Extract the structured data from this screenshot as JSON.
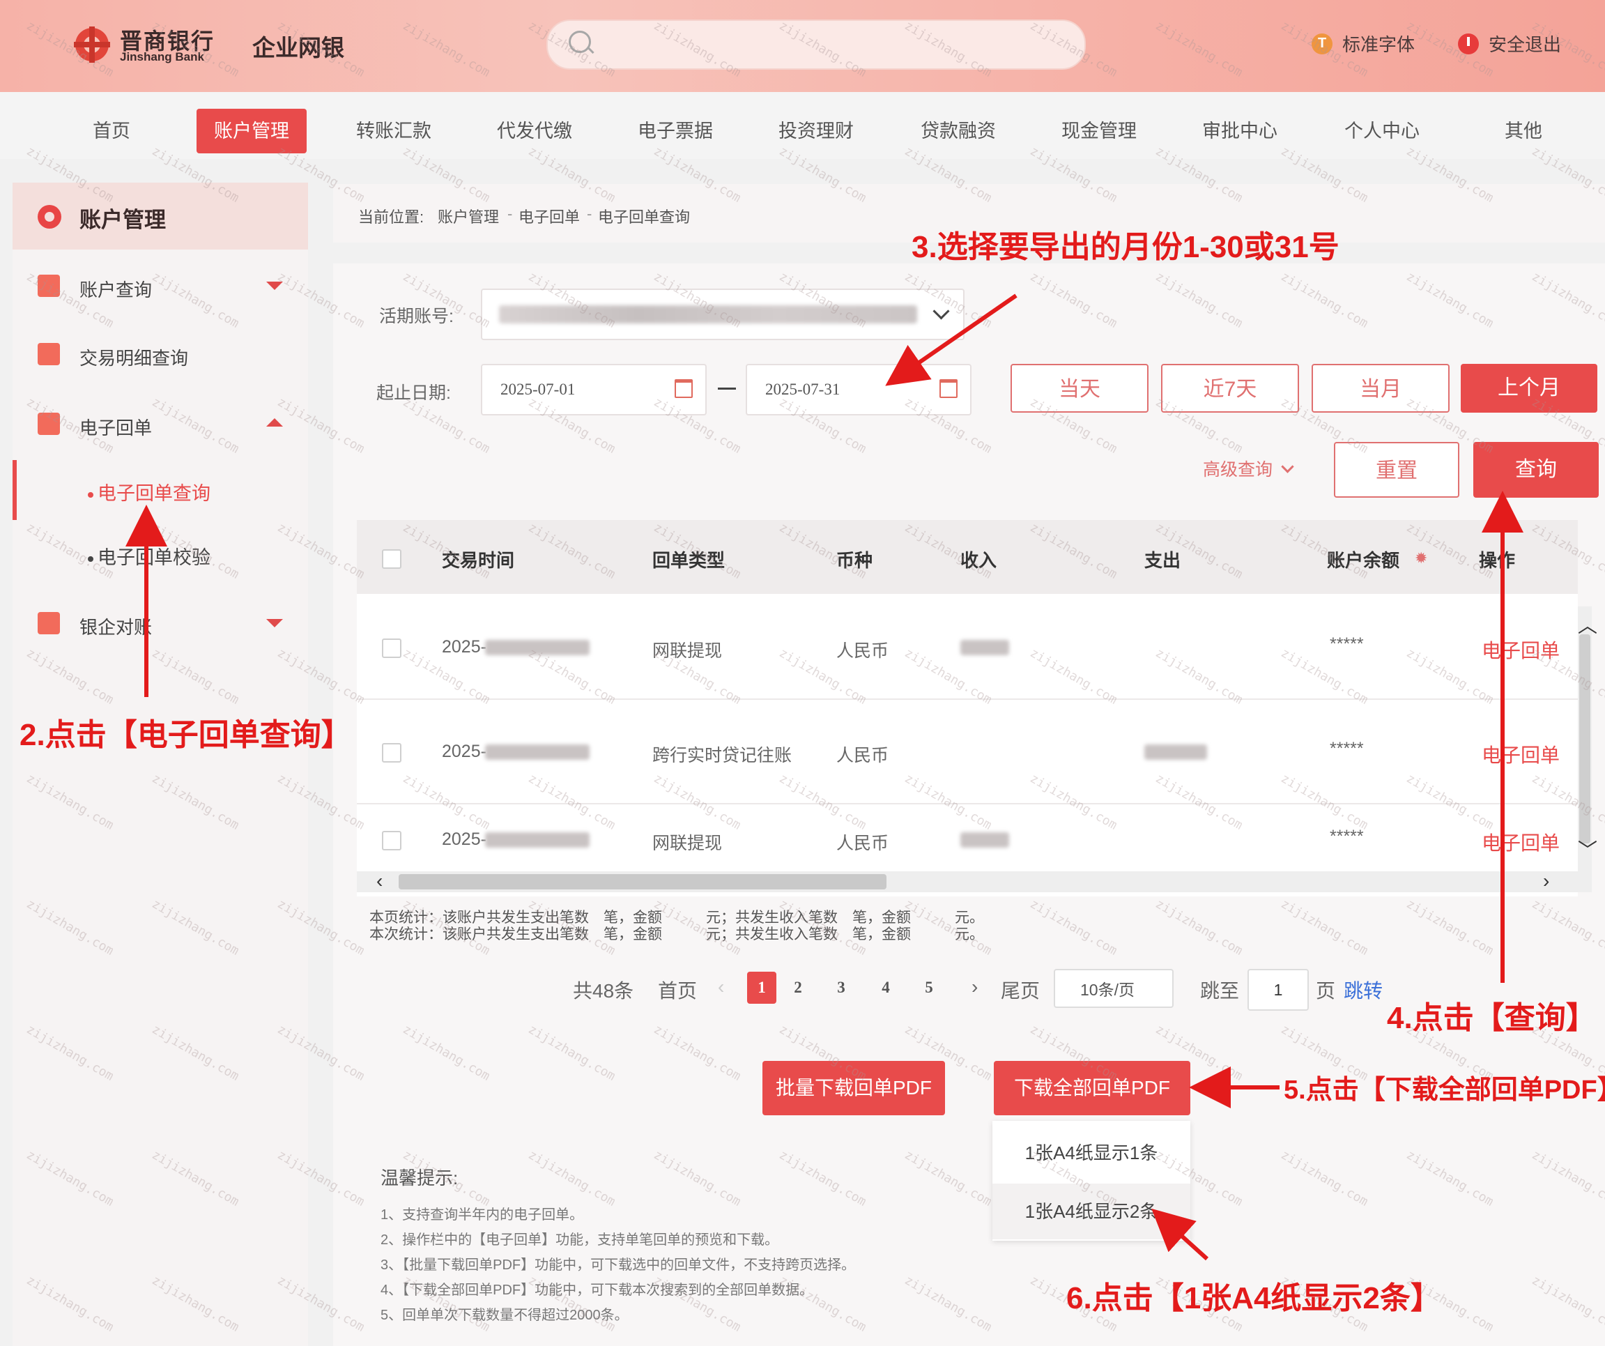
{
  "header": {
    "bank_name_cn": "晋商银行",
    "bank_name_en": "Jinshang Bank",
    "system_name": "企业网银",
    "font_link": "标准字体",
    "exit_link": "安全退出"
  },
  "nav": {
    "items": [
      "首页",
      "账户管理",
      "转账汇款",
      "代发代缴",
      "电子票据",
      "投资理财",
      "贷款融资",
      "现金管理",
      "审批中心",
      "个人中心",
      "其他"
    ],
    "active": "账户管理"
  },
  "sidebar": {
    "title": "账户管理",
    "items": [
      {
        "label": "账户查询"
      },
      {
        "label": "交易明细查询"
      },
      {
        "label": "电子回单"
      },
      {
        "label": "银企对账"
      }
    ],
    "subitems": [
      "电子回单查询",
      "电子回单校验"
    ]
  },
  "breadcrumb": {
    "prefix": "当前位置:",
    "path": [
      "账户管理",
      "电子回单",
      "电子回单查询"
    ]
  },
  "form": {
    "account_label": "活期账号:",
    "date_label": "起止日期:",
    "start_date": "2025-07-01",
    "end_date": "2025-07-31",
    "quick_buttons": [
      "当天",
      "近7天",
      "当月",
      "上个月"
    ],
    "advanced_label": "高级查询",
    "reset_label": "重置",
    "query_label": "查询"
  },
  "table": {
    "headers": [
      "交易时间",
      "回单类型",
      "币种",
      "收入",
      "支出",
      "账户余额",
      "操作"
    ],
    "rows": [
      {
        "time": "2025-",
        "type": "网联提现",
        "currency": "人民币",
        "balance": "*****",
        "action": "电子回单"
      },
      {
        "time": "2025-",
        "type": "跨行实时贷记往账",
        "currency": "人民币",
        "balance": "*****",
        "action": "电子回单"
      },
      {
        "time": "2025-",
        "type": "网联提现",
        "currency": "人民币",
        "balance": "*****",
        "action": "电子回单"
      }
    ]
  },
  "stats": {
    "page_line": "本页统计：该账户共发生支出笔数　笔，金额　　　元；共发生收入笔数　笔，金额　　　元。",
    "query_line": "本次统计：该账户共发生支出笔数　笔，金额　　　元；共发生收入笔数　笔，金额　　　元。"
  },
  "pager": {
    "total": "共48条",
    "first": "首页",
    "pages": [
      "1",
      "2",
      "3",
      "4",
      "5"
    ],
    "current": "1",
    "last": "尾页",
    "page_size": "10条/页",
    "jump_label": "跳至",
    "jump_value": "1",
    "page_unit": "页",
    "jump_button": "跳转"
  },
  "download": {
    "batch_label": "批量下载回单PDF",
    "all_label": "下载全部回单PDF",
    "options": [
      "1张A4纸显示1条",
      "1张A4纸显示2条"
    ]
  },
  "tips": {
    "title": "温馨提示:",
    "items": [
      "1、支持查询半年内的电子回单。",
      "2、操作栏中的【电子回单】功能，支持单笔回单的预览和下载。",
      "3、【批量下载回单PDF】功能中，可下载选中的回单文件，不支持跨页选择。",
      "4、【下载全部回单PDF】功能中，可下载本次搜索到的全部回单数据。",
      "5、回单单次下载数量不得超过2000条。"
    ]
  },
  "annotations": {
    "step2": "2.点击【电子回单查询】",
    "step3": "3.选择要导出的月份1-30或31号",
    "step4": "4.点击【查询】",
    "step5": "5.点击【下载全部回单PDF】",
    "step6": "6.点击【1张A4纸显示2条】"
  },
  "watermark": "zijizhang.com",
  "colors": {
    "accent": "#e84b4b",
    "header_bg": "#f6b2a8",
    "annotation": "#e31b1b"
  }
}
